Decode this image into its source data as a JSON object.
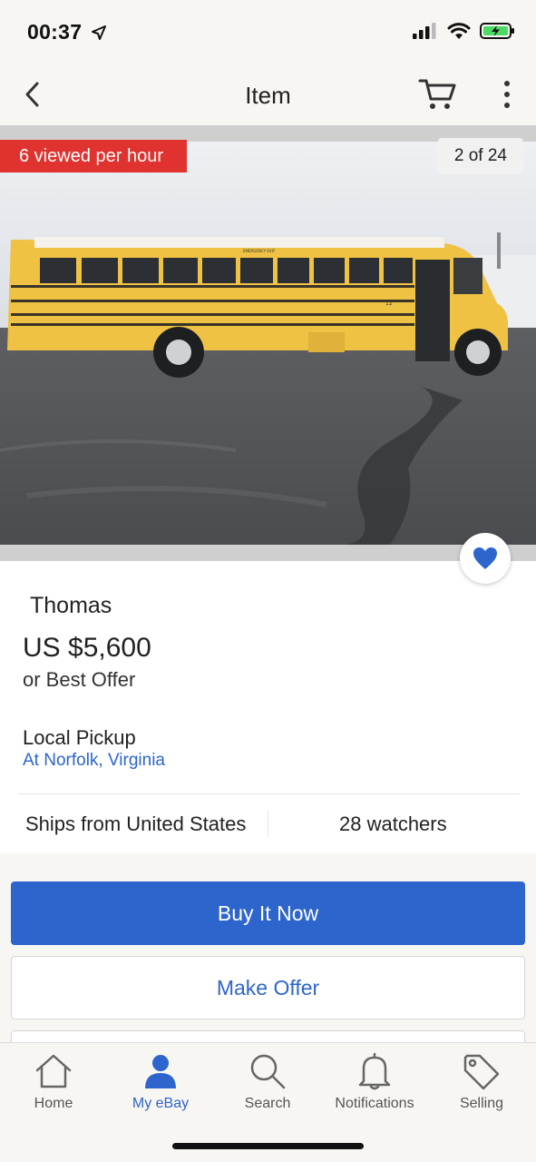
{
  "status_bar": {
    "time": "00:37"
  },
  "navbar": {
    "title": "Item"
  },
  "gallery": {
    "viewed_badge": "6 viewed per hour",
    "counter": "2 of 24",
    "bus_number": "12",
    "bus_sign": "EMERGENCY EXIT"
  },
  "item": {
    "title": "Thomas",
    "price": "US $5,600",
    "offer_text": "or Best Offer",
    "pickup_label": "Local Pickup",
    "pickup_location": "At Norfolk, Virginia",
    "ships_from": "Ships from United States",
    "watchers": "28 watchers"
  },
  "actions": {
    "buy_now": "Buy It Now",
    "make_offer": "Make Offer"
  },
  "tabs": [
    {
      "label": "Home",
      "icon": "house-icon"
    },
    {
      "label": "My eBay",
      "icon": "person-icon"
    },
    {
      "label": "Search",
      "icon": "magnifier-icon"
    },
    {
      "label": "Notifications",
      "icon": "bell-icon"
    },
    {
      "label": "Selling",
      "icon": "tag-icon"
    }
  ],
  "colors": {
    "accent": "#2d65cc",
    "badge_red": "#e0322f",
    "bus_yellow": "#efc244"
  }
}
